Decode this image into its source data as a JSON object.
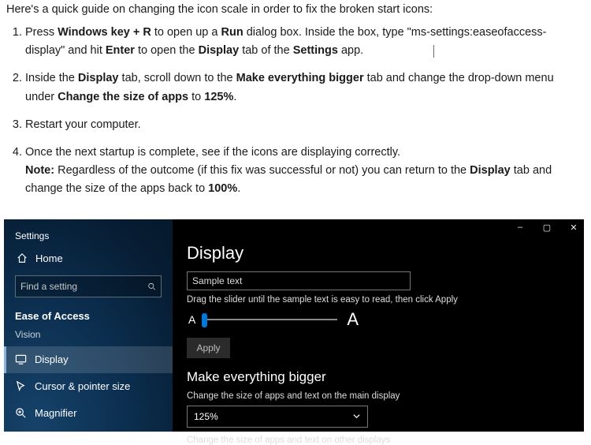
{
  "article": {
    "intro": "Here's a quick guide on changing the icon scale in order to fix the broken start icons:",
    "steps": [
      {
        "pre": "Press ",
        "b1": "Windows key + R",
        "mid1": " to open up a ",
        "b2": "Run",
        "mid2": " dialog box. Inside the box, type \"ms-se",
        "split": "ttings:easeofaccess-display\" and hit ",
        "b3": "Enter",
        "mid3": " to open the ",
        "b4": "Display",
        "mid4": " tab of the ",
        "b5": "Settings",
        "mid5": " app."
      },
      {
        "pre": "Inside the ",
        "b1": "Display",
        "mid1": " tab, scroll down to the ",
        "b2": "Make everything bigger",
        "mid2": " tab and change the drop-down menu under ",
        "b3": "Change the size of apps",
        "mid3": " to ",
        "b4": "125%",
        "mid4": "."
      },
      {
        "text": "Restart your computer."
      },
      {
        "pre": "Once the next startup is complete, see if the icons are displaying correctly.",
        "br": true,
        "noteLabel": "Note:",
        "note1": " Regardless of the outcome (if this fix was successful or not) you can return to the ",
        "b1": "Display",
        "note2": " tab and change the size of the apps back to ",
        "b2": "100%",
        "note3": "."
      }
    ]
  },
  "win": {
    "controls": {
      "min": "–",
      "max": "▢",
      "close": "✕"
    },
    "sidebar": {
      "title": "Settings",
      "home": "Home",
      "search_placeholder": "Find a setting",
      "ease": "Ease of Access",
      "group": "Vision",
      "items": [
        {
          "label": "Display"
        },
        {
          "label": "Cursor & pointer size"
        },
        {
          "label": "Magnifier"
        }
      ]
    },
    "content": {
      "title": "Display",
      "sample": "Sample text",
      "hint": "Drag the slider until the sample text is easy to read, then click Apply",
      "letterA": "A",
      "apply": "Apply",
      "section_title": "Make everything bigger",
      "section_sub": "Change the size of apps and text on the main display",
      "scale": "125%",
      "section_foot": "Change the size of apps and text on other displays"
    }
  }
}
